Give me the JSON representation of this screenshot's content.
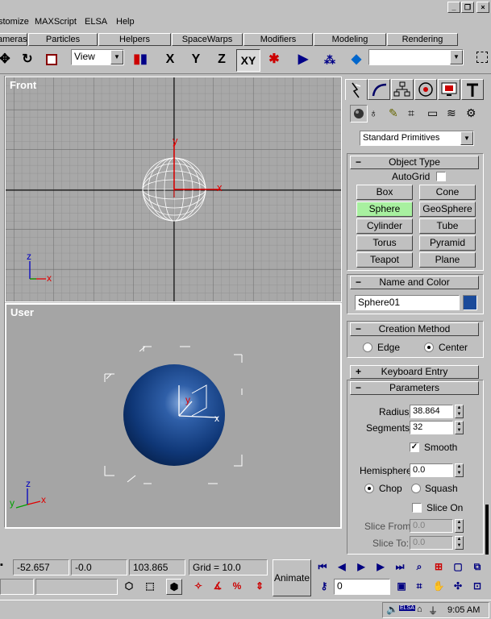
{
  "menu": [
    {
      "label": "stomize"
    },
    {
      "label": "MAXScript"
    },
    {
      "label": "ELSA"
    },
    {
      "label": "Help"
    }
  ],
  "tabs": [
    "ameras",
    "Particles",
    "Helpers",
    "SpaceWarps",
    "Modifiers",
    "Modeling",
    "Rendering"
  ],
  "toolbar": {
    "view_combo": "View",
    "axis_x": "X",
    "axis_y": "Y",
    "axis_z": "Z",
    "axis_xy": "XY",
    "named_selection": ""
  },
  "viewports": {
    "front_label": "Front",
    "user_label": "User",
    "front_axes": {
      "y": "y",
      "x": "x",
      "z": "z"
    },
    "user_axes": {
      "z": "z",
      "x": "x",
      "y": "y"
    }
  },
  "command_panel": {
    "category_combo": "Standard Primitives",
    "object_type": {
      "title": "Object Type",
      "autogrid": "AutoGrid",
      "buttons": [
        "Box",
        "Cone",
        "Sphere",
        "GeoSphere",
        "Cylinder",
        "Tube",
        "Torus",
        "Pyramid",
        "Teapot",
        "Plane"
      ],
      "active": "Sphere"
    },
    "name_color": {
      "title": "Name and Color",
      "name": "Sphere01",
      "color": "#1a4a9a"
    },
    "creation_method": {
      "title": "Creation Method",
      "edge": "Edge",
      "center": "Center",
      "selected": "Center"
    },
    "keyboard_entry": {
      "title": "Keyboard Entry"
    },
    "parameters": {
      "title": "Parameters",
      "radius_label": "Radius:",
      "radius": "38.864",
      "segments_label": "Segments:",
      "segments": "32",
      "smooth": "Smooth",
      "hemisphere_label": "Hemisphere:",
      "hemisphere": "0.0",
      "chop": "Chop",
      "squash": "Squash",
      "slice_on": "Slice On",
      "slice_from_label": "Slice From:",
      "slice_from": "0.0",
      "slice_to_label": "Slice To:",
      "slice_to": "0.0"
    }
  },
  "status": {
    "x": "-52.657",
    "y": "-0.0",
    "z": "103.865",
    "grid": "Grid = 10.0",
    "animate": "Animate",
    "frame": "0"
  },
  "taskbar": {
    "time": "9:05 AM",
    "tray_label": "ELSA"
  }
}
